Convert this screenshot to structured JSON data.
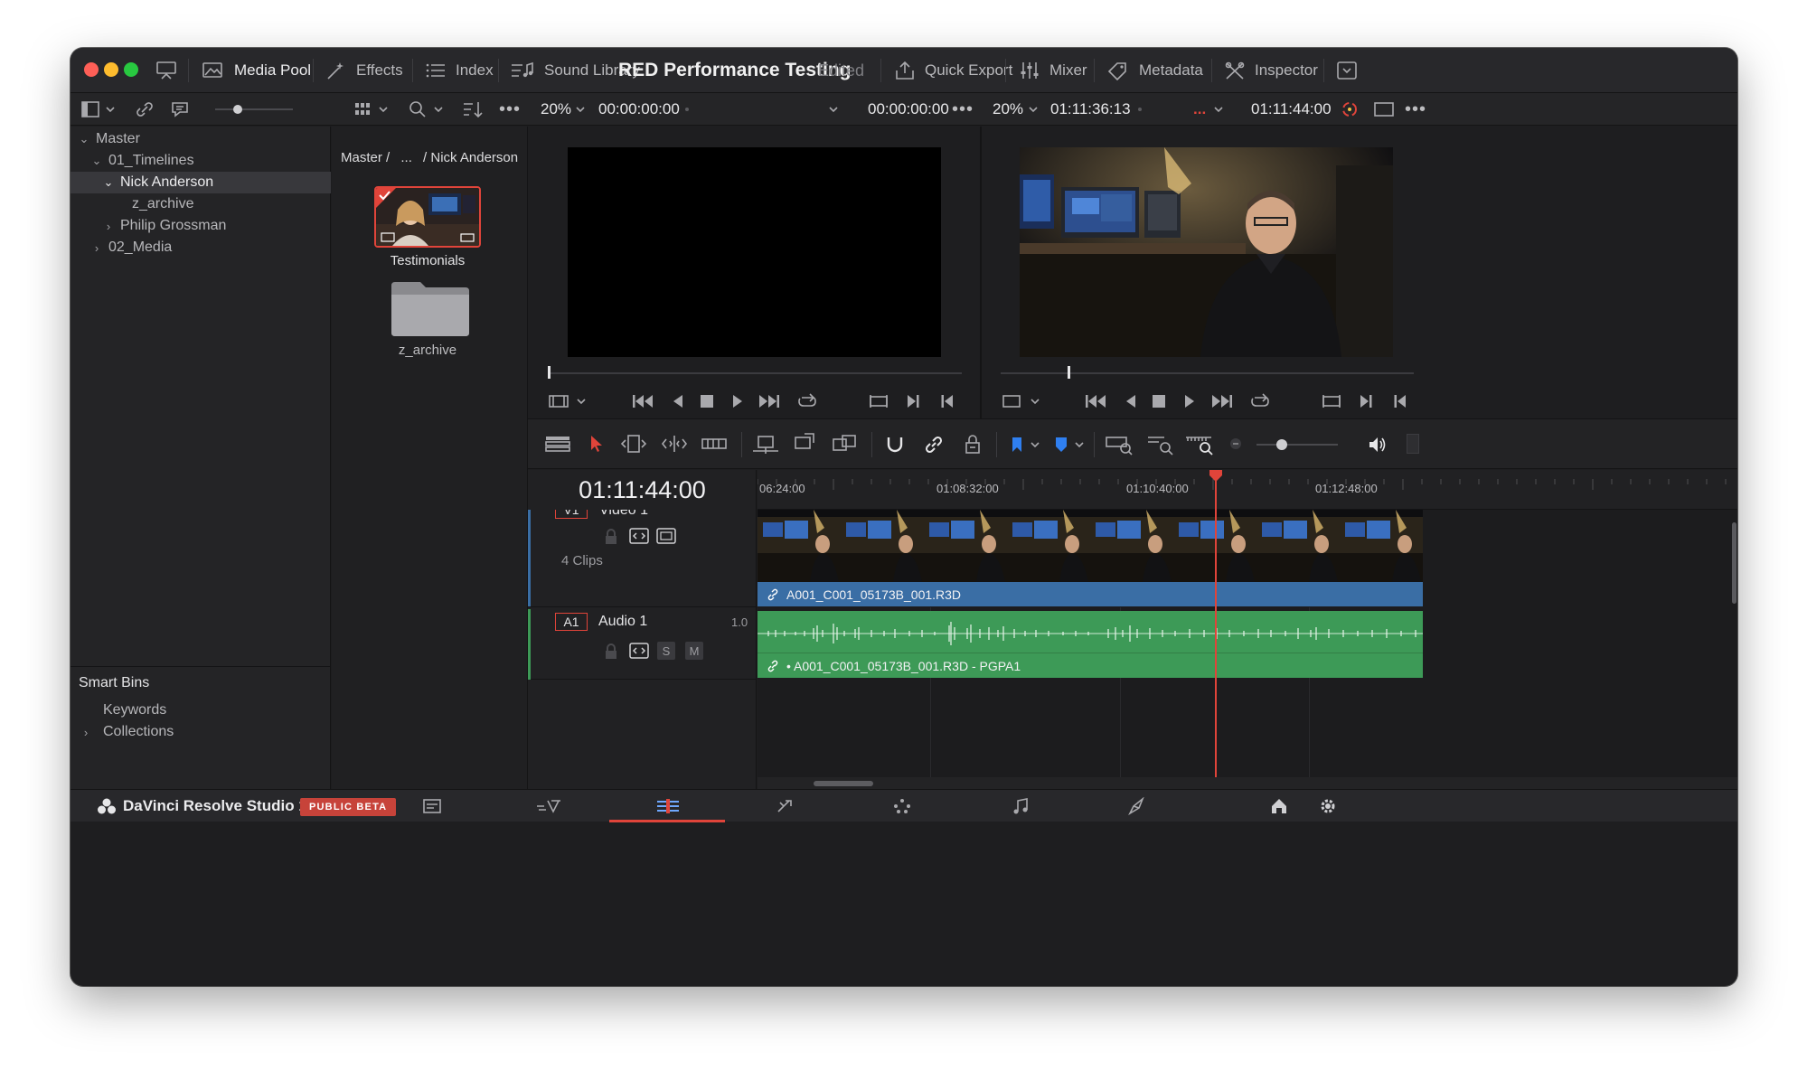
{
  "titlebar": {
    "media_pool": "Media Pool",
    "effects": "Effects",
    "index": "Index",
    "sound_library": "Sound Library",
    "project_title": "RED Performance Testing",
    "edited": "Edited",
    "quick_export": "Quick Export",
    "mixer": "Mixer",
    "metadata": "Metadata",
    "inspector": "Inspector"
  },
  "toolbar": {
    "source_zoom": "20%",
    "source_tc_in": "00:00:00:00",
    "source_tc_out": "00:00:00:00",
    "timeline_zoom": "20%",
    "timeline_duration": "01:11:36:13",
    "timeline_ellipsis": "...",
    "timeline_tc": "01:11:44:00"
  },
  "bins": {
    "master": "Master",
    "timelines": "01_Timelines",
    "nick_anderson": "Nick Anderson",
    "z_archive": "z_archive",
    "philip_grossman": "Philip Grossman",
    "media": "02_Media",
    "smart_bins": "Smart Bins",
    "keywords": "Keywords",
    "collections": "Collections"
  },
  "pool": {
    "breadcrumb_master": "Master /",
    "breadcrumb_ellipsis": "...",
    "breadcrumb_current": "/ Nick Anderson",
    "item1": "Testimonials",
    "item2": "z_archive"
  },
  "timeline": {
    "timecode": "01:11:44:00",
    "ruler": [
      "06:24:00",
      "01:08:32:00",
      "01:10:40:00",
      "01:12:48:00"
    ],
    "video_track_id": "V1",
    "video_track_name": "Video 1",
    "video_clips": "4 Clips",
    "video_clip_name": "A001_C001_05173B_001.R3D",
    "audio_track_id": "A1",
    "audio_track_name": "Audio 1",
    "audio_level": "1.0",
    "audio_solo": "S",
    "audio_mute": "M",
    "audio_clip_name": "• A001_C001_05173B_001.R3D - PGPA1"
  },
  "app": {
    "name": "DaVinci Resolve Studio 18.5",
    "badge": "PUBLIC BETA"
  },
  "colors": {
    "accent_red": "#e0443a",
    "video_clip": "#3a6ea5",
    "audio_clip": "#3d9a57"
  }
}
